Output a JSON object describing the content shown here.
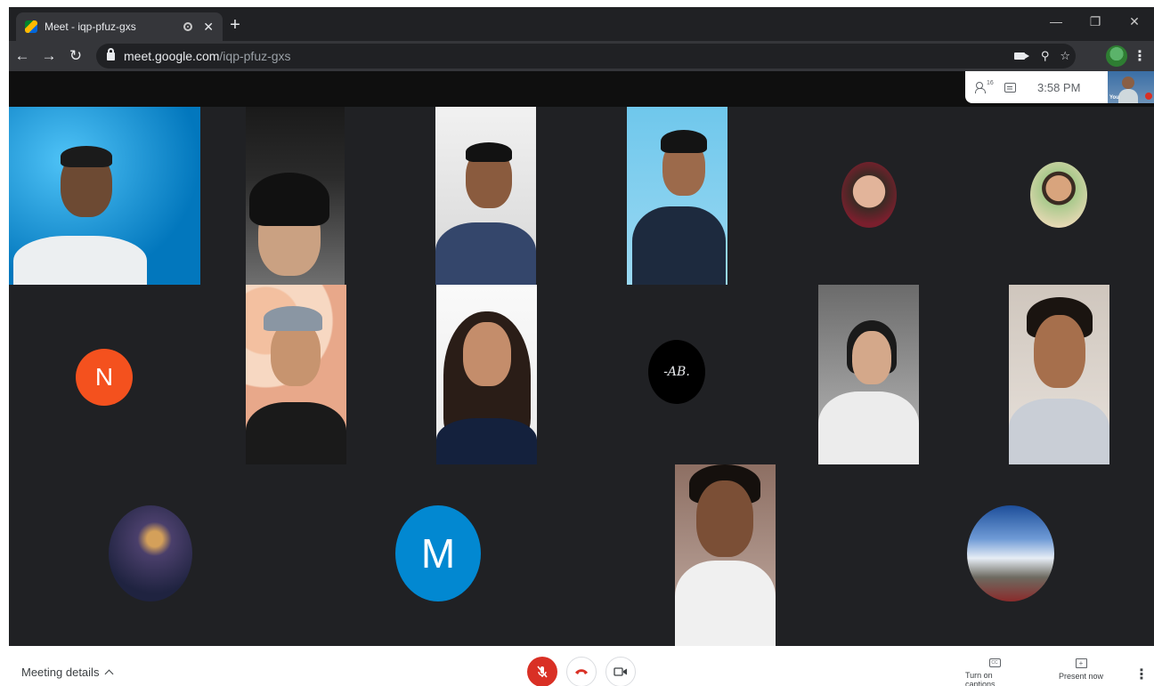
{
  "browser": {
    "tab_title": "Meet - iqp-pfuz-gxs",
    "url_host": "meet.google.com",
    "url_path": "/iqp-pfuz-gxs"
  },
  "icons": {
    "back": "arrow-left",
    "forward": "arrow-right",
    "reload": "reload",
    "lock": "lock",
    "camera": "camera",
    "zoom": "magnifier",
    "bookmark": "star",
    "more": "vertical-dots"
  },
  "meet": {
    "people_count": "16",
    "time": "3:58 PM",
    "self_label": "You",
    "participants": [
      {
        "kind": "video",
        "initial": ""
      },
      {
        "kind": "video",
        "initial": ""
      },
      {
        "kind": "video",
        "initial": ""
      },
      {
        "kind": "video",
        "initial": ""
      },
      {
        "kind": "photo-avatar",
        "initial": ""
      },
      {
        "kind": "photo-avatar",
        "initial": ""
      },
      {
        "kind": "letter-avatar",
        "initial": "N",
        "color": "#f4511e"
      },
      {
        "kind": "video",
        "initial": ""
      },
      {
        "kind": "video",
        "initial": ""
      },
      {
        "kind": "signature-avatar",
        "initial": "-AB.",
        "color": "#000000"
      },
      {
        "kind": "video",
        "initial": ""
      },
      {
        "kind": "video",
        "initial": ""
      },
      {
        "kind": "photo-avatar",
        "initial": ""
      },
      {
        "kind": "letter-avatar",
        "initial": "M",
        "color": "#0288d1"
      },
      {
        "kind": "video",
        "initial": ""
      },
      {
        "kind": "photo-avatar",
        "initial": ""
      }
    ]
  },
  "bottom": {
    "meeting_details": "Meeting details",
    "captions_label": "Turn on captions",
    "captions_icon_text": "CC",
    "present_label": "Present now",
    "mic_state": "muted"
  },
  "colors": {
    "stage_bg": "#202124",
    "mute_red": "#d93025",
    "hangup_red": "#d93025"
  }
}
